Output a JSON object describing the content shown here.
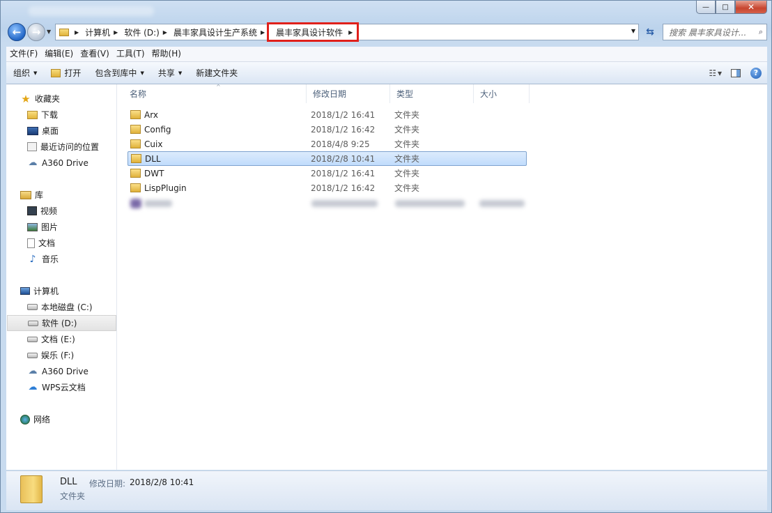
{
  "window": {
    "controls": {
      "minimize": "—",
      "maximize": "□",
      "close": "✕"
    }
  },
  "nav": {
    "back_glyph": "←",
    "forward_glyph": "→",
    "breadcrumbs": [
      "计算机",
      "软件 (D:)",
      "晨丰家具设计生产系统",
      "晨丰家具设计软件"
    ],
    "search_placeholder": "搜索 晨丰家具设计...",
    "highlight_color": "#e0201b"
  },
  "menubar": {
    "items": [
      "文件(F)",
      "编辑(E)",
      "查看(V)",
      "工具(T)",
      "帮助(H)"
    ]
  },
  "toolbar": {
    "organize": "组织",
    "open": "打开",
    "include_library": "包含到库中",
    "share": "共享",
    "new_folder": "新建文件夹",
    "help_glyph": "?"
  },
  "sidebar": {
    "favorites": {
      "title": "收藏夹",
      "items": [
        "下载",
        "桌面",
        "最近访问的位置",
        "A360 Drive"
      ]
    },
    "libraries": {
      "title": "库",
      "items": [
        "视频",
        "图片",
        "文档",
        "音乐"
      ]
    },
    "computer": {
      "title": "计算机",
      "items": [
        "本地磁盘 (C:)",
        "软件 (D:)",
        "文档 (E:)",
        "娱乐 (F:)",
        "A360 Drive",
        "WPS云文档"
      ]
    },
    "network": {
      "title": "网络"
    },
    "selected": "软件 (D:)"
  },
  "file_list": {
    "columns": [
      "名称",
      "修改日期",
      "类型",
      "大小"
    ],
    "rows": [
      {
        "name": "Arx",
        "modified": "2018/1/2 16:41",
        "type": "文件夹"
      },
      {
        "name": "Config",
        "modified": "2018/1/2 16:42",
        "type": "文件夹"
      },
      {
        "name": "Cuix",
        "modified": "2018/4/8 9:25",
        "type": "文件夹"
      },
      {
        "name": "DLL",
        "modified": "2018/2/8 10:41",
        "type": "文件夹"
      },
      {
        "name": "DWT",
        "modified": "2018/1/2 16:41",
        "type": "文件夹"
      },
      {
        "name": "LispPlugin",
        "modified": "2018/1/2 16:42",
        "type": "文件夹"
      }
    ],
    "selected_row": "DLL"
  },
  "details": {
    "name": "DLL",
    "modified_label": "修改日期:",
    "modified": "2018/2/8 10:41",
    "type": "文件夹"
  }
}
